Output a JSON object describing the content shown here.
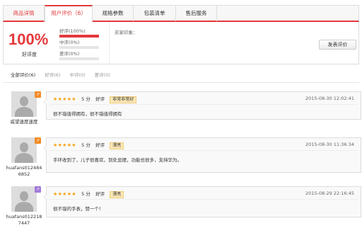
{
  "tabs": [
    {
      "label": "商品详情"
    },
    {
      "label": "用户评价（6）"
    },
    {
      "label": "规格参数"
    },
    {
      "label": "包装清单"
    },
    {
      "label": "售后服务"
    }
  ],
  "summary": {
    "percent": "100%",
    "percent_label": "好评度",
    "bars": [
      {
        "label": "好评(100%)",
        "fraction": 1.0
      },
      {
        "label": "中评(0%)",
        "fraction": 0.0
      },
      {
        "label": "差评(0%)",
        "fraction": 0.0
      }
    ],
    "impression_label": "买家印象：",
    "write_button": "发表评价"
  },
  "filters": [
    {
      "label": "全部评价(6)"
    },
    {
      "label": "好评(6)"
    },
    {
      "label": "中评(0)"
    },
    {
      "label": "差评(0)"
    }
  ],
  "colors": {
    "accent": "#e4393c",
    "star": "#f8a312",
    "level_orange": "#f28c28",
    "level_purple": "#a27ad9"
  },
  "reviews": [
    {
      "username": "威望速度速度",
      "stars": "★★★★★",
      "score": "5 分",
      "grade": "好评",
      "tag": "非常非常好",
      "time": "2015-08-30 12:02:41",
      "content": "很不错值得拥有，很不错值得拥有",
      "level_color": "#f28c28",
      "level_glyph": "↗"
    },
    {
      "username": "huafans0124846852",
      "stars": "★★★★★",
      "score": "5 分",
      "grade": "好评",
      "tag": "漂亮",
      "time": "2015-08-30 11:36:34",
      "content": "手环收到了，儿子很喜欢，到处显摆，功能也很多，支持华为。",
      "level_color": "#f28c28",
      "level_glyph": "↗"
    },
    {
      "username": "huafans0122187447",
      "stars": "★★★★★",
      "score": "5 分",
      "grade": "好评",
      "tag": "漂亮",
      "time": "2015-08-29 22:16:45",
      "content": "很不错的手表，赞一个！",
      "level_color": "#a27ad9",
      "level_glyph": "↗"
    }
  ]
}
